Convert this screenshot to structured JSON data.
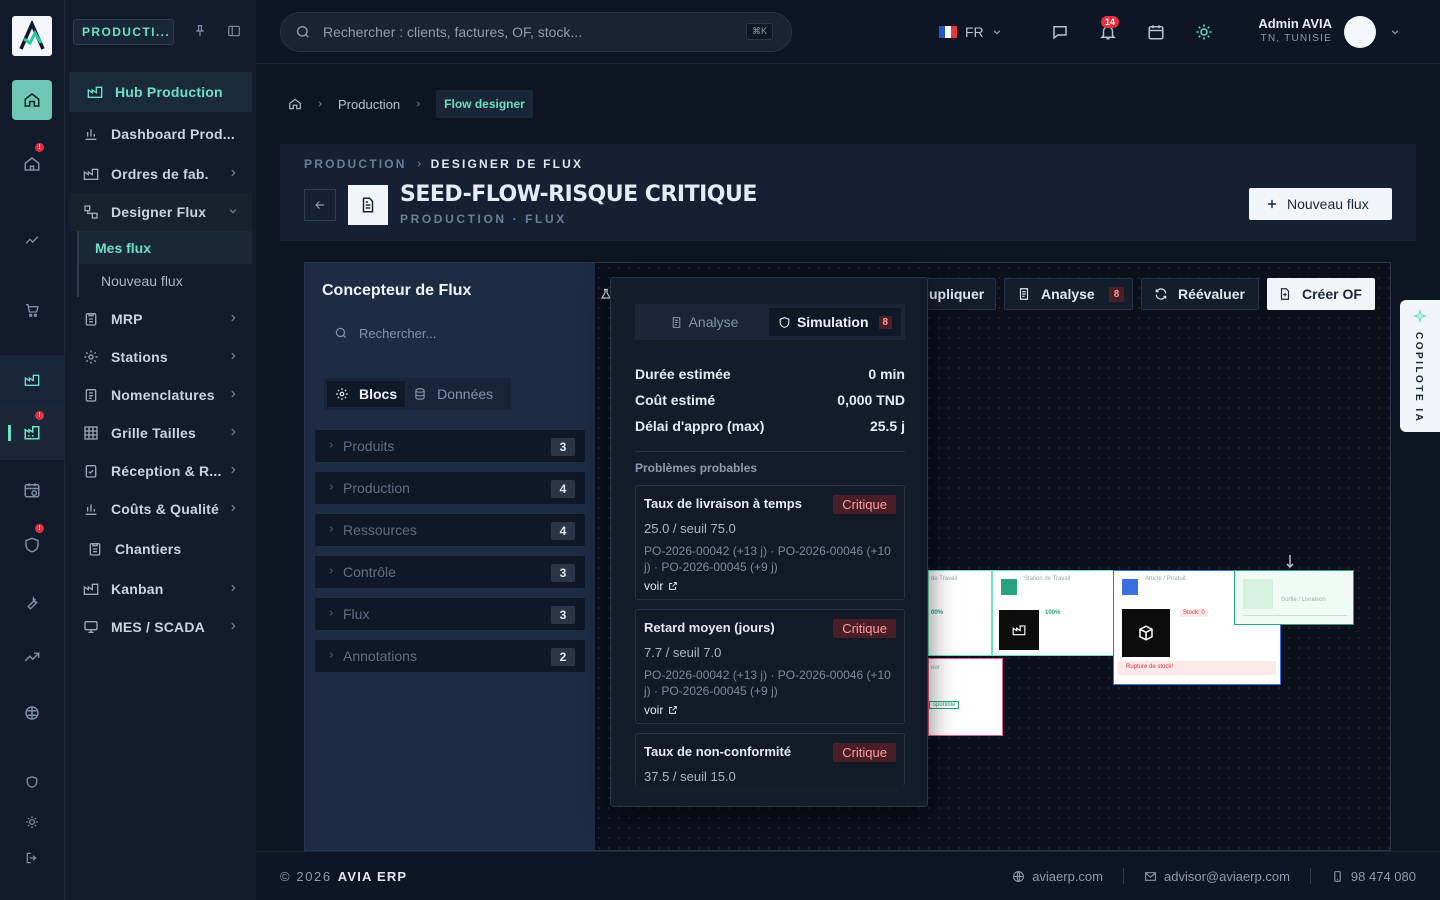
{
  "app": {
    "brand_initial": "A"
  },
  "rail": {
    "items": [
      {
        "name": "home",
        "badge": ""
      },
      {
        "name": "home-alert",
        "badge": "!"
      },
      {
        "name": "trend",
        "badge": ""
      },
      {
        "name": "cart",
        "badge": ""
      },
      {
        "name": "factory",
        "badge": ""
      },
      {
        "name": "production",
        "badge": "!"
      },
      {
        "name": "calendar-clock",
        "badge": ""
      },
      {
        "name": "shield",
        "badge": "!"
      },
      {
        "name": "wrench",
        "badge": ""
      },
      {
        "name": "trend-up",
        "badge": ""
      },
      {
        "name": "brain",
        "badge": ""
      }
    ]
  },
  "nav": {
    "module": "PRODUCTI...",
    "hub": "Hub Production",
    "items": [
      {
        "label": "Dashboard Prod..."
      },
      {
        "label": "Ordres de fab."
      },
      {
        "label": "Designer Flux"
      },
      {
        "label": "MRP"
      },
      {
        "label": "Stations"
      },
      {
        "label": "Nomenclatures"
      },
      {
        "label": "Grille Tailles"
      },
      {
        "label": "Réception & R..."
      },
      {
        "label": "Coûts & Qualité"
      },
      {
        "label": "Chantiers"
      },
      {
        "label": "Kanban"
      },
      {
        "label": "MES / SCADA"
      }
    ],
    "sub": {
      "mes_flux": "Mes flux",
      "nouveau_flux": "Nouveau flux"
    }
  },
  "topbar": {
    "search_placeholder": "Rechercher : clients, factures, OF, stock...",
    "shortcut": "⌘K",
    "lang": "FR",
    "notif_count": "14",
    "user_name": "Admin AVIA",
    "user_loc": "TN, TUNISIE"
  },
  "breadcrumb": {
    "home": "home",
    "section": "Production",
    "current": "Flow designer"
  },
  "header": {
    "kicker_left": "PRODUCTION",
    "kicker_right": "DESIGNER DE FLUX",
    "title": "SEED-FLOW-RISQUE CRITIQUE",
    "subtitle": "PRODUCTION · FLUX",
    "new_flow": "Nouveau flux"
  },
  "designer": {
    "panel_title": "Concepteur de Flux",
    "search_placeholder": "Rechercher...",
    "tab_blocks": "Blocs",
    "tab_data": "Données",
    "categories": [
      {
        "label": "Produits",
        "count": "3"
      },
      {
        "label": "Production",
        "count": "4"
      },
      {
        "label": "Ressources",
        "count": "4"
      },
      {
        "label": "Contrôle",
        "count": "3"
      },
      {
        "label": "Flux",
        "count": "3"
      },
      {
        "label": "Annotations",
        "count": "2"
      }
    ],
    "toolbar": {
      "dup": "upliquer",
      "analyse": "Analyse",
      "analyse_count": "8",
      "reeval": "Réévaluer",
      "create_of": "Créer OF"
    },
    "popover": {
      "tab_analyse": "Analyse",
      "tab_sim": "Simulation",
      "tab_sim_count": "8",
      "metrics": [
        {
          "label": "Durée estimée",
          "value": "0 min"
        },
        {
          "label": "Coût estimé",
          "value": "0,000 TND"
        },
        {
          "label": "Délai d'appro (max)",
          "value": "25.5 j"
        }
      ],
      "problems_title": "Problèmes probables",
      "problems": [
        {
          "title": "Taux de livraison à temps",
          "badge": "Critique",
          "value": "25.0 / seuil 75.0",
          "refs": "PO-2026-00042 (+13 j) · PO-2026-00046 (+10 j) · PO-2026-00045 (+9 j)",
          "link": "voir"
        },
        {
          "title": "Retard moyen (jours)",
          "badge": "Critique",
          "value": "7.7 / seuil 7.0",
          "refs": "PO-2026-00042 (+13 j) · PO-2026-00046 (+10 j) · PO-2026-00045 (+9 j)",
          "link": "voir"
        },
        {
          "title": "Taux de non-conformité",
          "badge": "Critique",
          "value": "37.5 / seuil 15.0"
        }
      ]
    },
    "nodes": {
      "n1_tag": "de Travail",
      "n1_pct": "00%",
      "n2_tag": "Station de Travail",
      "n2_pct": "100%",
      "n3_tag": "Article / Produit",
      "n3_stock": "Stock: 0",
      "n3_alert": "Rupture de stock!",
      "n4_tag": "Sortie / Livraison",
      "n5_status": "sponible",
      "n5_tag": "eur"
    }
  },
  "copilot": {
    "label": "COPILOTE IA"
  },
  "footer": {
    "copy": "© 2026",
    "brand": "AVIA ERP",
    "site": "aviaerp.com",
    "email": "advisor@aviaerp.com",
    "phone": "98 474 080"
  },
  "colors": {
    "accent": "#6fe0c4",
    "critical": "#ff9ba5",
    "danger": "#e53040"
  }
}
